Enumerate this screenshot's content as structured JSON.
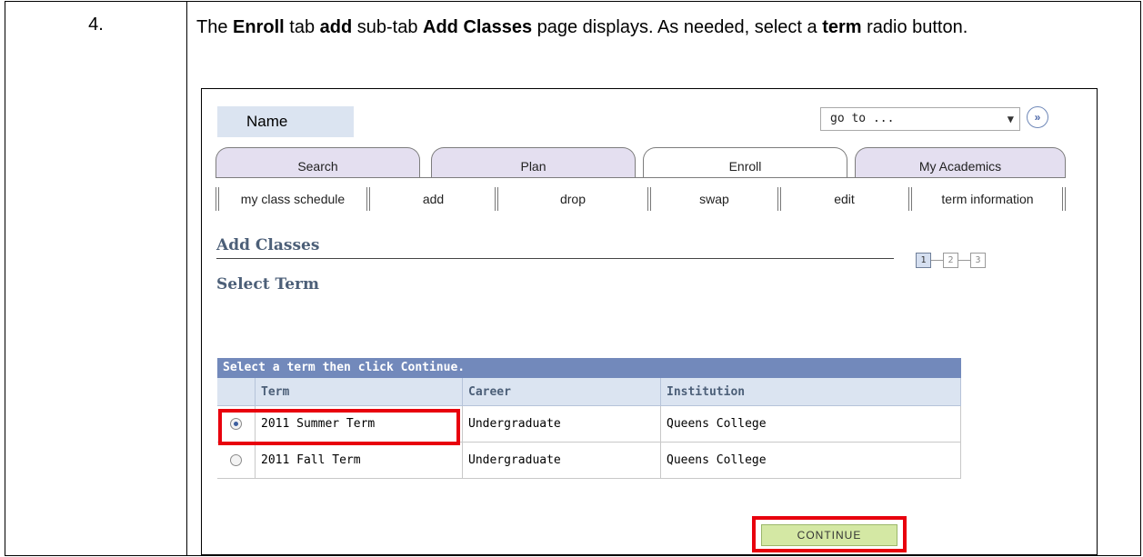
{
  "document": {
    "step_number": "4.",
    "instruction_parts": [
      {
        "text": "The ",
        "bold": false
      },
      {
        "text": "Enroll",
        "bold": true
      },
      {
        "text": " tab ",
        "bold": false
      },
      {
        "text": "add",
        "bold": true
      },
      {
        "text": " sub-tab ",
        "bold": false
      },
      {
        "text": "Add Classes",
        "bold": true
      },
      {
        "text": " page displays.  As needed, select a ",
        "bold": false
      },
      {
        "text": "term",
        "bold": true
      },
      {
        "text": " radio button.",
        "bold": false
      }
    ]
  },
  "header": {
    "name_label": "Name",
    "goto_value": "go to ...",
    "goto_button_icon": "double-chevron-right-icon"
  },
  "tabs": [
    {
      "label": "Search",
      "active": false
    },
    {
      "label": "Plan",
      "active": false
    },
    {
      "label": "Enroll",
      "active": true
    },
    {
      "label": "My Academics",
      "active": false
    }
  ],
  "subtabs": [
    {
      "label": "my class schedule"
    },
    {
      "label": "add"
    },
    {
      "label": "drop"
    },
    {
      "label": "swap"
    },
    {
      "label": "edit"
    },
    {
      "label": "term information"
    }
  ],
  "page": {
    "title": "Add Classes",
    "section_title": "Select Term",
    "steps": [
      "1",
      "2",
      "3"
    ],
    "active_step": "1"
  },
  "grid": {
    "caption": "Select a term then click Continue.",
    "columns": [
      "Term",
      "Career",
      "Institution"
    ],
    "rows": [
      {
        "selected": true,
        "term": "2011 Summer Term",
        "career": "Undergraduate",
        "institution": "Queens College"
      },
      {
        "selected": false,
        "term": "2011 Fall Term",
        "career": "Undergraduate",
        "institution": "Queens College"
      }
    ]
  },
  "actions": {
    "continue_label": "CONTINUE"
  },
  "colors": {
    "highlight": "#e8000d",
    "grid_header": "#7289bb",
    "tab_inactive": "#e4dff0",
    "continue_button": "#d4e8a4"
  }
}
